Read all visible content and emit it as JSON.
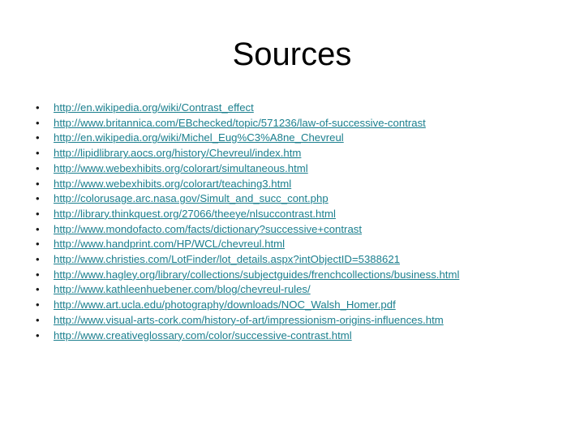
{
  "slide": {
    "title": "Sources",
    "bullet_glyph": "•",
    "link_color": "#1b7f8e",
    "title_color": "#000000",
    "background_color": "#ffffff",
    "sources": [
      {
        "url": "http://en.wikipedia.org/wiki/Contrast_effect"
      },
      {
        "url": "http://www.britannica.com/EBchecked/topic/571236/law-of-successive-contrast"
      },
      {
        "url": "http://en.wikipedia.org/wiki/Michel_Eug%C3%A8ne_Chevreul"
      },
      {
        "url": "http://lipidlibrary.aocs.org/history/Chevreul/index.htm"
      },
      {
        "url": "http://www.webexhibits.org/colorart/simultaneous.html"
      },
      {
        "url": "http://www.webexhibits.org/colorart/teaching3.html"
      },
      {
        "url": "http://colorusage.arc.nasa.gov/Simult_and_succ_cont.php"
      },
      {
        "url": "http://library.thinkquest.org/27066/theeye/nlsuccontrast.html"
      },
      {
        "url": "http://www.mondofacto.com/facts/dictionary?successive+contrast"
      },
      {
        "url": "http://www.handprint.com/HP/WCL/chevreul.html"
      },
      {
        "url": "http://www.christies.com/LotFinder/lot_details.aspx?intObjectID=5388621"
      },
      {
        "url": "http://www.hagley.org/library/collections/subjectguides/frenchcollections/business.html"
      },
      {
        "url": "http://www.kathleenhuebener.com/blog/chevreul-rules/"
      },
      {
        "url": "http://www.art.ucla.edu/photography/downloads/NOC_Walsh_Homer.pdf"
      },
      {
        "url": "http://www.visual-arts-cork.com/history-of-art/impressionism-origins-influences.htm"
      },
      {
        "url": "http://www.creativeglossary.com/color/successive-contrast.html"
      }
    ]
  }
}
